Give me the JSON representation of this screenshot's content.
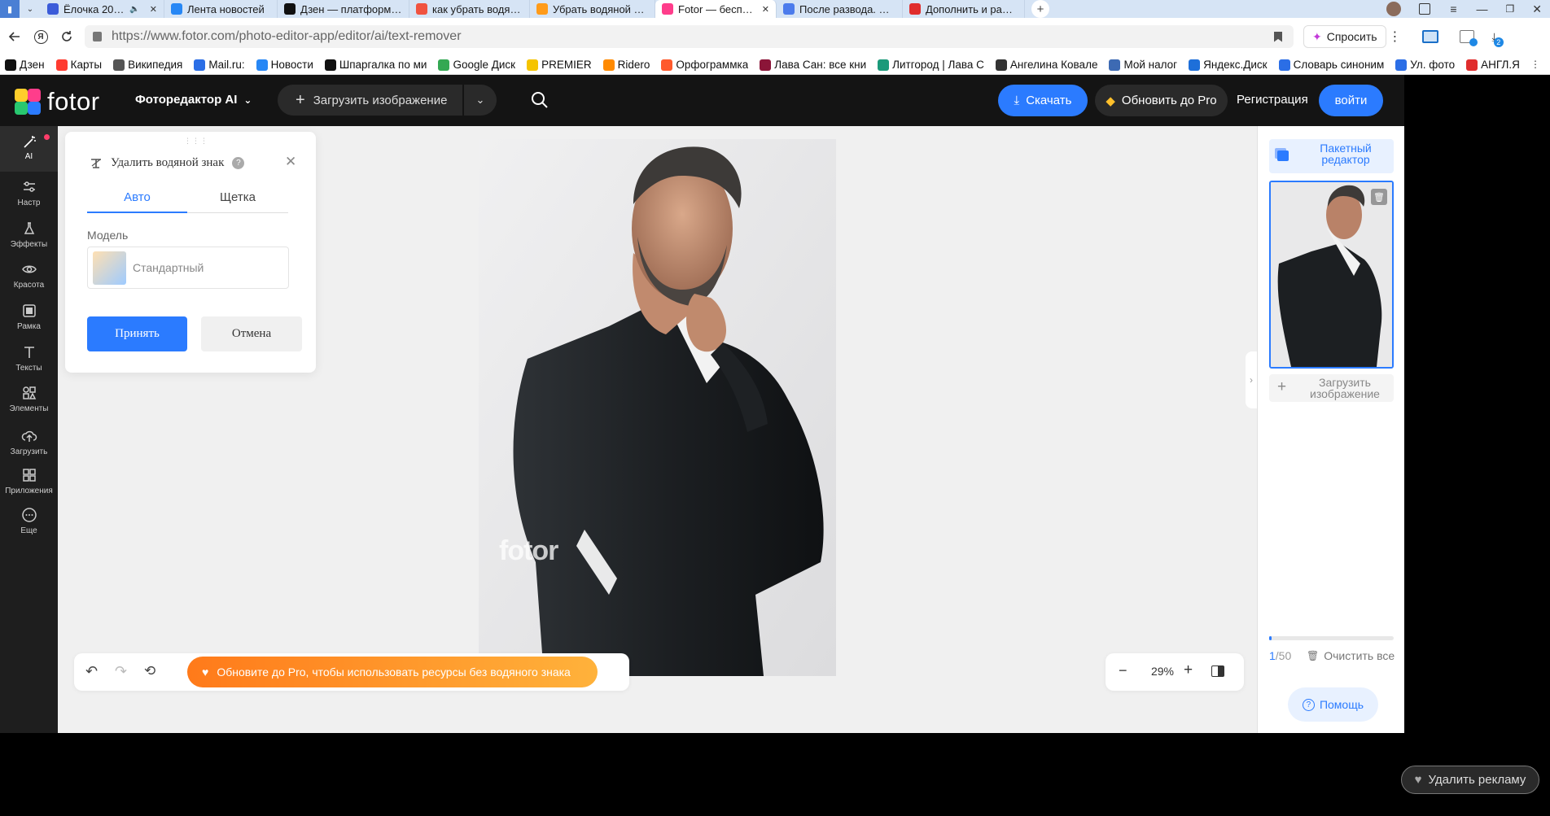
{
  "browser": {
    "tabs": [
      {
        "label": "Ёлочка 2025",
        "icon": "play-icon",
        "color": "#3a5bd9"
      },
      {
        "label": "Лента новостей",
        "icon": "vk-icon",
        "color": "#2787f5"
      },
      {
        "label": "Дзен — платформа для",
        "icon": "dzen-icon",
        "color": "#111111"
      },
      {
        "label": "как убрать водяные зна",
        "icon": "yandex-icon",
        "color": "#f05340"
      },
      {
        "label": "Убрать водяной знак с",
        "icon": "fotor-icon",
        "color": "#ff9b1a"
      },
      {
        "label": "Fotor — бесплатный",
        "icon": "fotor-icon",
        "color": "#ff3d8b"
      },
      {
        "label": "После развода. Прощен",
        "icon": "doc-icon",
        "color": "#4b7bec"
      },
      {
        "label": "Дополнить и расширит",
        "icon": "opera-icon",
        "color": "#e02d2d"
      }
    ],
    "url_domain": "https://www.fotor.com",
    "url_path": "/photo-editor-app/editor/ai/text-remover",
    "ask_label": "Спросить",
    "download_badge": "2",
    "bookmarks": [
      {
        "label": "Дзен",
        "color": "#111111"
      },
      {
        "label": "Карты",
        "color": "#ff3b30"
      },
      {
        "label": "Википедия",
        "color": "#555555"
      },
      {
        "label": "Mail.ru:",
        "color": "#2b6ee6"
      },
      {
        "label": "Новости",
        "color": "#2787f5"
      },
      {
        "label": "Шпаргалка по ми",
        "color": "#111111"
      },
      {
        "label": "Google Диск",
        "color": "#34a853"
      },
      {
        "label": "PREMIER",
        "color": "#f5c400"
      },
      {
        "label": "Ridero",
        "color": "#ff8a00"
      },
      {
        "label": "Орфограммка",
        "color": "#ff5a2c"
      },
      {
        "label": "Лава Сан: все кни",
        "color": "#8b1538"
      },
      {
        "label": "Литгород | Лава С",
        "color": "#1b9a7a"
      },
      {
        "label": "Ангелина Ковале",
        "color": "#333333"
      },
      {
        "label": "Мой налог",
        "color": "#3d6ab3"
      },
      {
        "label": "Яндекс.Диск",
        "color": "#1e6fd9"
      },
      {
        "label": "Словарь синоним",
        "color": "#2b6ee6"
      },
      {
        "label": "Ул. фото",
        "color": "#2b6ee6"
      },
      {
        "label": "АНГЛ.Я",
        "color": "#e02d2d"
      }
    ]
  },
  "app": {
    "logo_text": "fotor",
    "editor_menu": "Фоторедактор AI",
    "upload_button": "Загрузить изображение",
    "download_button": "Скачать",
    "upgrade_button": "Обновить до Pro",
    "register_link": "Регистрация",
    "login_button": "войти",
    "accent": "#2b7bff",
    "upgrade_accent": "#ff8c00"
  },
  "sidebar": {
    "items": [
      {
        "label": "AI",
        "icon": "magic-wand-icon"
      },
      {
        "label": "Настр",
        "icon": "sliders-icon"
      },
      {
        "label": "Эффекты",
        "icon": "flask-icon"
      },
      {
        "label": "Красота",
        "icon": "eye-icon"
      },
      {
        "label": "Рамка",
        "icon": "frame-icon"
      },
      {
        "label": "Тексты",
        "icon": "text-icon"
      },
      {
        "label": "Элементы",
        "icon": "shapes-icon"
      },
      {
        "label": "Загрузить",
        "icon": "cloud-upload-icon"
      },
      {
        "label": "Приложения",
        "icon": "apps-icon"
      },
      {
        "label": "Еще",
        "icon": "more-icon"
      }
    ]
  },
  "panel": {
    "title": "Удалить водяной знак",
    "tabs": [
      "Авто",
      "Щетка"
    ],
    "model_label": "Модель",
    "model_value": "Стандартный",
    "apply_button": "Принять",
    "cancel_button": "Отмена"
  },
  "canvas": {
    "watermark_text": "fotor",
    "promo_text": "Обновите до Pro, чтобы использовать ресурсы без водяного знака",
    "zoom": "29%"
  },
  "right_panel": {
    "batch_label": "Пакетный редактор",
    "upload_label": "Загрузить изображение",
    "count_current": "1",
    "count_total": "/50",
    "clear_label": "Очистить все",
    "help_label": "Помощь"
  },
  "ad": {
    "remove_ads": "Удалить рекламу"
  }
}
